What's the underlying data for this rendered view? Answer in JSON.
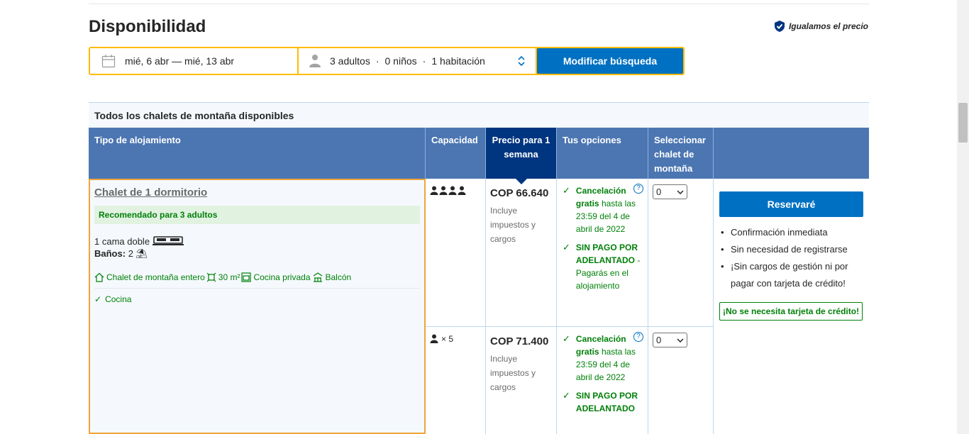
{
  "section": {
    "title": "Disponibilidad",
    "price_match": "Igualamos el precio"
  },
  "search": {
    "dates": "mié, 6 abr — mié, 13 abr",
    "adults": "3 adultos",
    "children": "0 niños",
    "rooms": "1 habitación",
    "button": "Modificar búsqueda"
  },
  "table": {
    "caption": "Todos los chalets de montaña disponibles",
    "headers": {
      "type": "Tipo de alojamiento",
      "capacity": "Capacidad",
      "price": "Precio para 1 semana",
      "options": "Tus opciones",
      "select": "Seleccionar chalet de montaña"
    },
    "room": {
      "name": "Chalet de 1 dormitorio",
      "recommended": "Recomendado para 3 adultos",
      "bed": "1 cama doble",
      "baths_label": "Baños:",
      "baths_value": "2",
      "facilities": [
        "Chalet de montaña entero",
        "30 m²",
        "Cocina privada",
        "Balcón"
      ],
      "kitchen": "Cocina"
    },
    "rows": [
      {
        "capacity_text": "",
        "price": "COP 66.640",
        "taxes": "Incluye impuestos y cargos",
        "cancel_bold": "Cancelación gratis",
        "cancel_rest": "hasta las 23:59 del 4 de abril de 2022",
        "prepay_bold": "SIN PAGO POR ADELANTADO",
        "prepay_rest": "- Pagarás en el alojamiento",
        "select_value": "0"
      },
      {
        "capacity_text": "× 5",
        "price": "COP 71.400",
        "taxes": "Incluye impuestos y cargos",
        "cancel_bold": "Cancelación gratis",
        "cancel_rest": "hasta las 23:59 del 4 de abril de 2022",
        "prepay_bold": "SIN PAGO POR ADELANTADO",
        "prepay_rest": "",
        "select_value": "0"
      }
    ],
    "reserve": {
      "button": "Reservaré",
      "benefits": [
        "Confirmación inmediata",
        "Sin necesidad de registrarse",
        "¡Sin cargos de gestión ni por pagar con tarjeta de crédito!"
      ],
      "no_card": "¡No se necesita tarjeta de crédito!"
    }
  },
  "colors": {
    "accent_blue": "#0071c2",
    "header_blue": "#4c76b2",
    "dark_blue": "#003580",
    "green": "#008009",
    "yellow": "#febb02"
  }
}
